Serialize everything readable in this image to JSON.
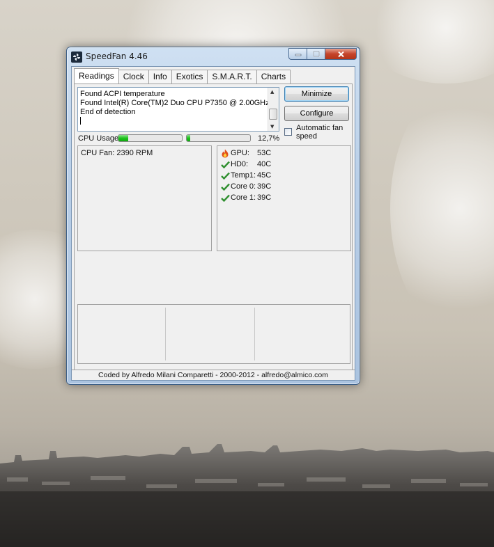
{
  "window": {
    "title": "SpeedFan 4.46",
    "buttons": {
      "minimize": "",
      "maximize": "",
      "close": ""
    }
  },
  "tabs": [
    {
      "label": "Readings",
      "active": true
    },
    {
      "label": "Clock",
      "active": false
    },
    {
      "label": "Info",
      "active": false
    },
    {
      "label": "Exotics",
      "active": false
    },
    {
      "label": "S.M.A.R.T.",
      "active": false
    },
    {
      "label": "Charts",
      "active": false
    }
  ],
  "log": {
    "lines": [
      "Found ACPI temperature",
      "Found Intel(R) Core(TM)2 Duo CPU P7350 @ 2.00GHz",
      "End of detection"
    ]
  },
  "actions": {
    "minimize_label": "Minimize",
    "configure_label": "Configure"
  },
  "auto_fan": {
    "label_line1": "Automatic fan",
    "label_line2": "speed",
    "checked": false
  },
  "cpu": {
    "label": "CPU Usage",
    "value_text": "12,7%",
    "core_loads": [
      0.15,
      0.05
    ]
  },
  "fans": [
    {
      "label": "CPU Fan:",
      "value": "2390 RPM"
    }
  ],
  "temperatures": [
    {
      "name": "GPU:",
      "value": "53C",
      "status": "hot",
      "icon": "flame-icon"
    },
    {
      "name": "HD0:",
      "value": "40C",
      "status": "ok",
      "icon": "check-icon"
    },
    {
      "name": "Temp1:",
      "value": "45C",
      "status": "ok",
      "icon": "check-icon"
    },
    {
      "name": "Core 0:",
      "value": "39C",
      "status": "ok",
      "icon": "check-icon"
    },
    {
      "name": "Core 1:",
      "value": "39C",
      "status": "ok",
      "icon": "check-icon"
    }
  ],
  "status_bar": {
    "text": "Coded by Alfredo Milani Comparetti - 2000-2012 - alfredo@almico.com"
  },
  "colors": {
    "ok_check": "#2f8f2f",
    "hot_flame": "#e0501a",
    "bar_fill": "#1cc31c"
  }
}
